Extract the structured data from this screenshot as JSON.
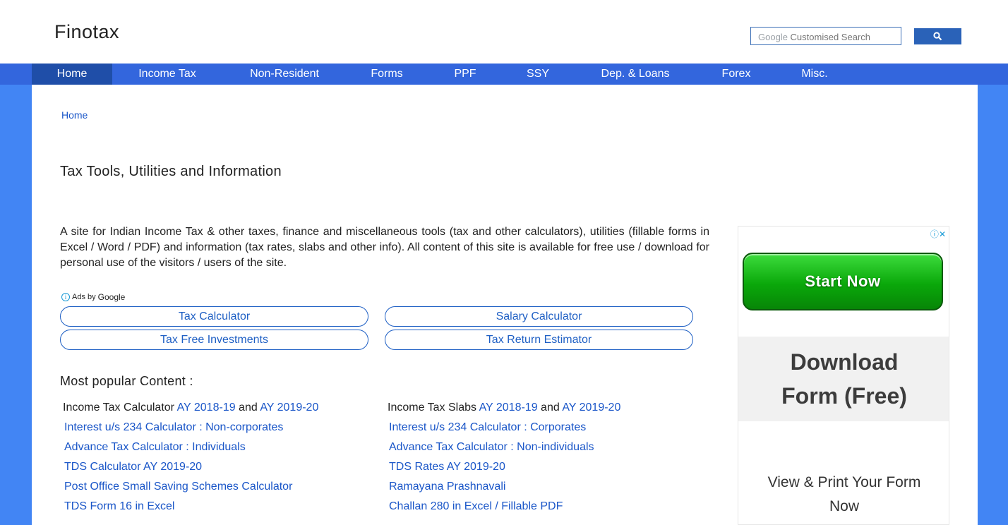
{
  "header": {
    "logo": "Finotax",
    "search": {
      "brand": "Google",
      "placeholder": "Customised Search"
    }
  },
  "nav": {
    "items": [
      {
        "label": "Home",
        "active": true
      },
      {
        "label": "Income Tax"
      },
      {
        "label": "Non-Resident"
      },
      {
        "label": "Forms"
      },
      {
        "label": "PPF"
      },
      {
        "label": "SSY"
      },
      {
        "label": "Dep. & Loans"
      },
      {
        "label": "Forex"
      },
      {
        "label": "Misc."
      }
    ]
  },
  "breadcrumb": "Home",
  "title": "Tax Tools, Utilities and Information",
  "intro": "A site for Indian Income Tax & other taxes, finance and miscellaneous tools (tax and other calculators), utilities (fillable forms in Excel / Word / PDF) and information (tax rates, slabs and other info). All content of this site is available for free use / download for personal use of the visitors / users of the site.",
  "ads_label": {
    "prefix": "Ads by",
    "brand": "Google"
  },
  "ad_links": [
    "Tax Calculator",
    "Salary Calculator",
    "Tax Free Investments",
    "Tax Return Estimator"
  ],
  "popular": {
    "title": "Most popular Content :",
    "left": {
      "first_row": {
        "text": "Income Tax Calculator",
        "link1": "AY 2018-19",
        "and": "and",
        "link2": "AY 2019-20"
      },
      "links": [
        "Interest u/s 234 Calculator : Non-corporates",
        "Advance Tax Calculator : Individuals",
        "TDS Calculator AY 2019-20",
        "Post Office Small Saving Schemes Calculator",
        "TDS Form 16 in Excel"
      ]
    },
    "right": {
      "first_row": {
        "text": "Income Tax Slabs",
        "link1": "AY 2018-19",
        "and": "and",
        "link2": "AY 2019-20"
      },
      "links": [
        "Interest u/s 234 Calculator : Corporates",
        "Advance Tax Calculator : Non-individuals",
        "TDS Rates AY 2019-20",
        "Ramayana Prashnavali",
        "Challan 280 in Excel / Fillable PDF"
      ]
    }
  },
  "side_ad": {
    "button": "Start Now",
    "download_line1": "Download",
    "download_line2": "Form (Free)",
    "view_line1": "View & Print Your Form",
    "view_line2": "Now"
  },
  "colors": {
    "nav_bg": "#3366dd",
    "nav_active": "#1f4ea8",
    "link": "#1a56c8",
    "page_bg": "#4285f4"
  }
}
